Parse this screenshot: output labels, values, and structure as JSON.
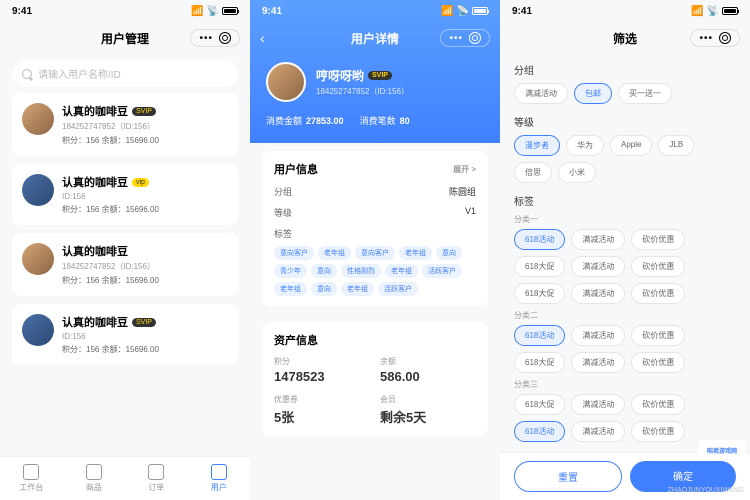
{
  "status_time": "9:41",
  "screen1": {
    "title": "用户管理",
    "search_placeholder": "请输入用户名称/ID",
    "users": [
      {
        "name": "认真的咖啡豆",
        "badge": "SVIP",
        "meta": "184252747852（ID:156）",
        "stats": "积分：156    余额：15696.00"
      },
      {
        "name": "认真的咖啡豆",
        "badge": "vip",
        "meta": "ID:156",
        "stats": "积分：156    余额：15696.00"
      },
      {
        "name": "认真的咖啡豆",
        "meta": "184252747852（ID:156）",
        "stats": "积分：156    余额：15696.00"
      },
      {
        "name": "认真的咖啡豆",
        "badge": "SVIP",
        "meta": "ID:156",
        "stats": "积分：156    余额：15696.00"
      }
    ],
    "tabs": [
      {
        "label": "工作台"
      },
      {
        "label": "商品"
      },
      {
        "label": "订单"
      },
      {
        "label": "用户"
      }
    ]
  },
  "screen2": {
    "title": "用户详情",
    "name": "哼呀呀哟",
    "badge": "SVIP",
    "id": "184252747852（ID:156）",
    "stat1_label": "消费金额",
    "stat1_val": "27853.00",
    "stat2_label": "消费笔数",
    "stat2_val": "80",
    "info_title": "用户信息",
    "info_expand": "展开 >",
    "group_label": "分组",
    "group_val": "陈圆组",
    "level_label": "等级",
    "level_val": "V1",
    "tags_label": "标签",
    "tags": [
      "意向客户",
      "老年组",
      "意向客户",
      "老年组",
      "意向",
      "青少年",
      "意向",
      "性格刚烈",
      "老年组",
      "活跃客户",
      "老年组",
      "意向",
      "老年组",
      "活跃客户"
    ],
    "asset_title": "资产信息",
    "assets": [
      {
        "label": "积分",
        "val": "1478523"
      },
      {
        "label": "余额",
        "val": "586.00"
      },
      {
        "label": "优惠券",
        "val": "5张"
      },
      {
        "label": "会员",
        "val": "剩余5天"
      }
    ]
  },
  "screen3": {
    "title": "筛选",
    "group_label": "分组",
    "group_chips": [
      "满减活动",
      "包邮",
      "买一送一"
    ],
    "level_label": "等级",
    "level_chips": [
      "漫步者",
      "华为",
      "Apple",
      "JLB",
      "倍思",
      "小米"
    ],
    "tags_label": "标签",
    "cat1": "分类一",
    "cat2": "分类二",
    "cat3": "分类三",
    "tag_rows": [
      [
        "618活动",
        "满减活动",
        "砍价优惠"
      ],
      [
        "618大促",
        "满减活动",
        "砍价优惠"
      ],
      [
        "618大促",
        "满减活动",
        "砍价优惠"
      ]
    ],
    "reset": "重置",
    "confirm": "确定",
    "watermark": "ZHAOJUNYOUXIWANG",
    "logo": "昭君游戏网"
  }
}
